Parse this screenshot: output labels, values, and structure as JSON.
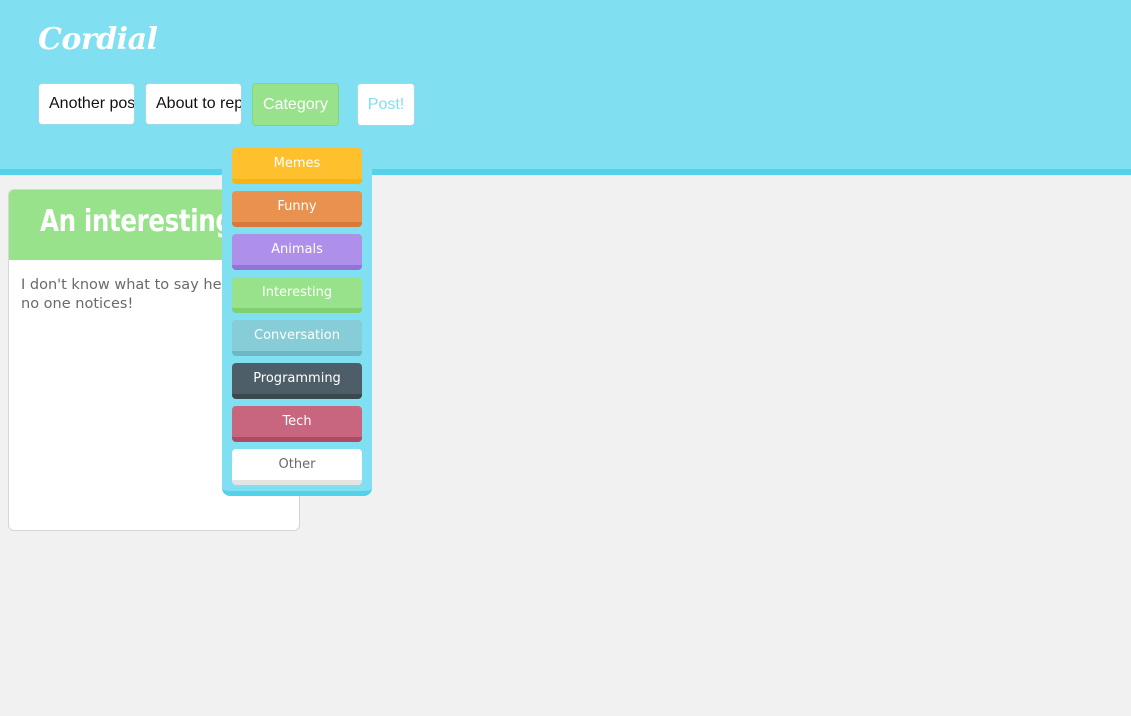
{
  "app": {
    "logo": "Cordial"
  },
  "composer": {
    "title_value": "Another post",
    "body_value": "About to reply",
    "category_label": "Category",
    "post_label": "Post!"
  },
  "post": {
    "title": "An interesting post",
    "body": "I don't know what to say here, that no one notices!"
  },
  "category_menu": {
    "items": [
      {
        "label": "Memes",
        "bg": "#fec02c",
        "edge": "#f9b214",
        "text": "#ffffff"
      },
      {
        "label": "Funny",
        "bg": "#e9924f",
        "edge": "#d9783b",
        "text": "#ffffff"
      },
      {
        "label": "Animals",
        "bg": "#ae90ea",
        "edge": "#9274d6",
        "text": "#ffffff"
      },
      {
        "label": "Interesting",
        "bg": "#97e28a",
        "edge": "#7fd06f",
        "text": "#ffffff"
      },
      {
        "label": "Conversation",
        "bg": "#86cdd8",
        "edge": "#6cb7c3",
        "text": "#ffffff"
      },
      {
        "label": "Programming",
        "bg": "#4e5e68",
        "edge": "#3a4850",
        "text": "#ffffff"
      },
      {
        "label": "Tech",
        "bg": "#c8657f",
        "edge": "#ae4a66",
        "text": "#ffffff"
      },
      {
        "label": "Other",
        "bg": "#ffffff",
        "edge": "#e4e4e4",
        "text": "#6a6a6a"
      }
    ]
  },
  "colors": {
    "header": "#80dff1",
    "accent_green": "#97e28a",
    "background": "#f1f1f1"
  }
}
